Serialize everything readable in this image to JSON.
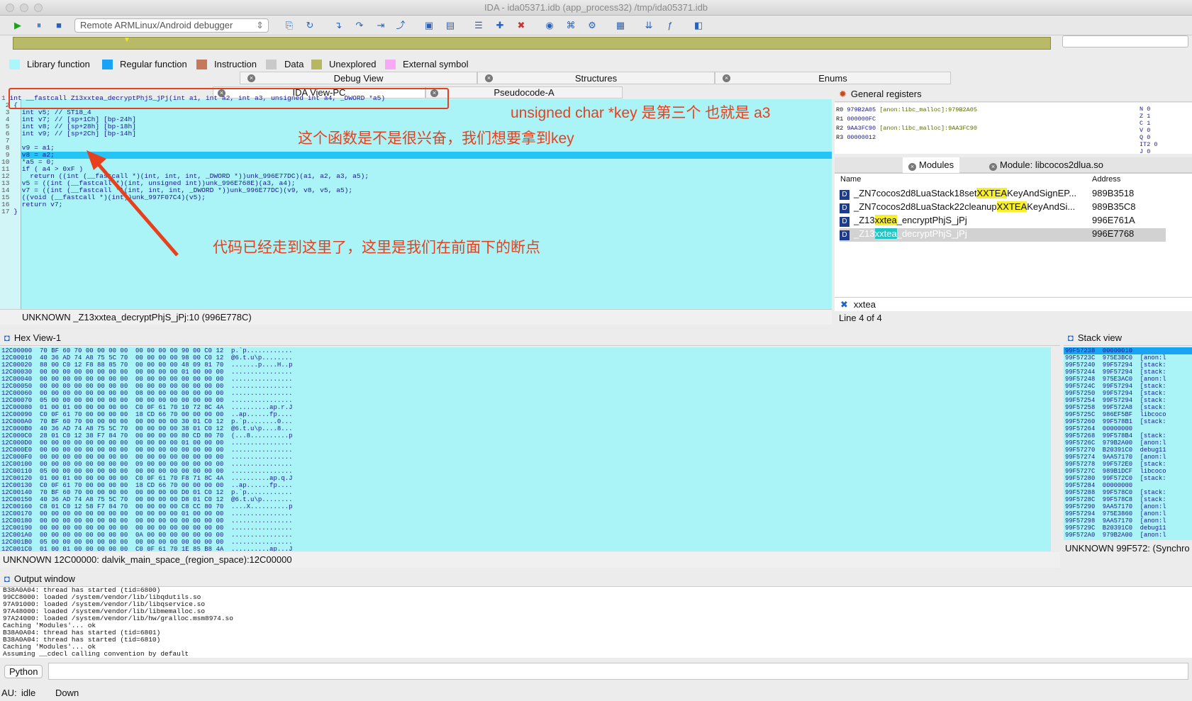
{
  "window": {
    "title": "IDA - ida05371.idb (app_process32) /tmp/ida05371.idb"
  },
  "toolbar": {
    "debugger": "Remote ARMLinux/Android debugger"
  },
  "legend": [
    {
      "label": "Library function",
      "color": "#a9f6fb"
    },
    {
      "label": "Regular function",
      "color": "#19a3f5"
    },
    {
      "label": "Instruction",
      "color": "#c47a5a"
    },
    {
      "label": "Data",
      "color": "#c9c9c9"
    },
    {
      "label": "Unexplored",
      "color": "#b6b861"
    },
    {
      "label": "External symbol",
      "color": "#f8a9f6"
    }
  ],
  "tabs_top": [
    "Debug View",
    "Structures",
    "Enums"
  ],
  "tabs_second": [
    "IDA View-PC",
    "Pseudocode-A"
  ],
  "code": {
    "header": "int __fastcall Z13xxtea_decryptPhjS_jPj(int a1, int a2, int a3, unsigned int a4, _DWORD *a5)",
    "lines": [
      {
        "n": "2",
        "t": "{"
      },
      {
        "n": "3",
        "t": "  int v5; // ST18_4"
      },
      {
        "n": "4",
        "t": "  int v7; // [sp+1Ch] [bp-24h]"
      },
      {
        "n": "5",
        "t": "  int v8; // [sp+28h] [bp-18h]"
      },
      {
        "n": "6",
        "t": "  int v9; // [sp+2Ch] [bp-14h]"
      },
      {
        "n": "7",
        "t": ""
      },
      {
        "n": "8",
        "t": "  v9 = a1;"
      },
      {
        "n": "9",
        "t": "  v8 = a2;"
      },
      {
        "n": "10",
        "t": "  *a5 = 0;"
      },
      {
        "n": "11",
        "t": "  if ( a4 > 0xF )"
      },
      {
        "n": "12",
        "t": "    return ((int (__fastcall *)(int, int, int, _DWORD *))unk_996E77DC)(a1, a2, a3, a5);"
      },
      {
        "n": "13",
        "t": "  v5 = ((int (__fastcall *)(int, unsigned int))unk_996E768E)(a3, a4);"
      },
      {
        "n": "14",
        "t": "  v7 = ((int (__fastcall *)(int, int, int, _DWORD *))unk_996E77DC)(v9, v8, v5, a5);"
      },
      {
        "n": "15",
        "t": "  ((void (__fastcall *)(int))unk_997F07C4)(v5);"
      },
      {
        "n": "16",
        "t": "  return v7;"
      },
      {
        "n": "17",
        "t": "}"
      }
    ]
  },
  "annotations": [
    "unsigned char *key 是第三个 也就是 a3",
    "这个函数是不是很兴奋，我们想要拿到key",
    "代码已经走到这里了，这里是我们在前面下的断点"
  ],
  "idaview_status": "UNKNOWN  _Z13xxtea_decryptPhjS_jPj:10 (996E778C)",
  "registers": {
    "title": "General registers",
    "rows": [
      {
        "r": "R0",
        "v": "979B2A05",
        "n": "[anon:libc_malloc]:979B2A05"
      },
      {
        "r": "R1",
        "v": "000000FC",
        "n": ""
      },
      {
        "r": "R2",
        "v": "9AA3FC90",
        "n": "[anon:libc_malloc]:9AA3FC90"
      },
      {
        "r": "R3",
        "v": "00000012",
        "n": ""
      }
    ],
    "flags": [
      [
        "N",
        "0"
      ],
      [
        "Z",
        "1"
      ],
      [
        "C",
        "1"
      ],
      [
        "V",
        "0"
      ],
      [
        "Q",
        "0"
      ],
      [
        "IT2",
        "0"
      ],
      [
        "J",
        "0"
      ]
    ]
  },
  "modules": {
    "tabs": [
      "Modules",
      "Module: libcocos2dlua.so"
    ],
    "cols": [
      "Name",
      "Address"
    ],
    "rows": [
      {
        "pre": "_ZN7cocos2d8LuaStack18set",
        "hl": "XXTEA",
        "post": "KeyAndSignEP...",
        "addr": "989B3518"
      },
      {
        "pre": "_ZN7cocos2d8LuaStack22cleanup",
        "hl": "XXTEA",
        "post": "KeyAndSi...",
        "addr": "989B35C8"
      },
      {
        "pre": "_Z13",
        "hl": "xxtea",
        "post": "_encryptPhjS_jPj",
        "addr": "996E761A"
      },
      {
        "pre": "_Z13",
        "hl": "xxtea",
        "post": "_decryptPhjS_jPj",
        "addr": "996E7768"
      }
    ],
    "search": "xxtea",
    "line_info": "Line 4 of 4"
  },
  "hexview": {
    "title": "Hex View-1",
    "status": "UNKNOWN  12C00000: dalvik_main_space_(region_space):12C00000",
    "rows": [
      "12C00000  70 BF 60 70 00 00 00 00  00 00 00 00 90 00 C0 12  p.`p............",
      "12C00010  40 36 AD 74 A8 75 5C 70  00 00 00 00 98 00 C0 12  @6.t.u\\p........",
      "12C00020  88 00 C0 12 F8 88 85 70  00 00 00 00 48 09 81 70  .......p....H..p",
      "12C00030  00 00 00 00 00 00 00 00  00 00 00 00 01 00 00 00  ................",
      "12C00040  00 00 00 00 00 00 00 00  00 00 00 00 00 00 00 00  ................",
      "12C00050  00 00 00 00 00 00 00 00  00 00 00 00 00 00 00 00  ................",
      "12C00060  00 00 00 00 00 00 00 00  08 00 00 00 00 00 00 00  ................",
      "12C00070  05 00 00 00 00 00 00 00  00 00 00 00 00 00 00 00  ................",
      "12C00080  01 00 01 00 00 00 00 00  C0 0F 61 70 10 72 8C 4A  ..........ap.r.J",
      "12C00090  C0 0F 61 70 00 00 00 00  18 CD 66 70 00 00 00 00  ..ap......fp....",
      "12C000A0  70 BF 60 70 00 00 00 00  00 00 00 00 30 01 C0 12  p.`p........0...",
      "12C000B0  40 36 AD 74 A8 75 5C 70  00 00 00 00 38 01 C0 12  @6.t.u\\p....8...",
      "12C000C0  28 01 C0 12 38 F7 84 70  00 00 00 00 80 CD 80 70  (...8..........p",
      "12C000D0  00 00 00 00 00 00 00 00  00 00 00 00 01 00 00 00  ................",
      "12C000E0  00 00 00 00 00 00 00 00  00 00 00 00 00 00 00 00  ................",
      "12C000F0  00 00 00 00 00 00 00 00  00 00 00 00 00 00 00 00  ................",
      "12C00100  00 00 00 00 00 00 00 00  09 00 00 00 00 00 00 00  ................",
      "12C00110  05 00 00 00 00 00 00 00  00 00 00 00 00 00 00 00  ................",
      "12C00120  01 00 01 00 00 00 00 00  C0 0F 61 70 F8 71 8C 4A  ..........ap.q.J",
      "12C00130  C0 0F 61 70 00 00 00 00  18 CD 66 70 00 00 00 00  ..ap......fp....",
      "12C00140  70 BF 60 70 00 00 00 00  00 00 00 00 D0 01 C0 12  p.`p............",
      "12C00150  40 36 AD 74 A8 75 5C 70  00 00 00 00 D8 01 C0 12  @6.t.u\\p........",
      "12C00160  C8 01 C0 12 58 F7 84 70  00 00 00 00 C8 CC 80 70  ....X..........p",
      "12C00170  00 00 00 00 00 00 00 00  00 00 00 00 01 00 00 00  ................",
      "12C00180  00 00 00 00 00 00 00 00  00 00 00 00 00 00 00 00  ................",
      "12C00190  00 00 00 00 00 00 00 00  00 00 00 00 00 00 00 00  ................",
      "12C001A0  00 00 00 00 00 00 00 00  0A 00 00 00 00 00 00 00  ................",
      "12C001B0  05 00 00 00 00 00 00 00  00 00 00 00 00 00 00 00  ................",
      "12C001C0  01 00 01 00 00 00 00 00  C0 0F 61 70 1E 85 B8 4A  ..........ap...J"
    ]
  },
  "stack": {
    "title": "Stack view",
    "status": "UNKNOWN 99F572: (Synchro",
    "rows": [
      "99F57238  00000010",
      "99F5723C  975E3BC0  [anon:l",
      "99F57240  99F57294  [stack:",
      "99F57244  99F57294  [stack:",
      "99F57248  975E3AC0  [anon:l",
      "99F5724C  99F57294  [stack:",
      "99F57250  99F57294  [stack:",
      "99F57254  99F57294  [stack:",
      "99F57258  99F572A8  [stack:",
      "99F5725C  986EF5BF  libcoco",
      "99F57260  99F578B1  [stack:",
      "99F57264  00000000",
      "99F57268  99F578B4  [stack:",
      "99F5726C  979B2A00  [anon:l",
      "99F57270  B20391C0  debug11",
      "99F57274  9AA57170  [anon:l",
      "99F57278  99F572E0  [stack:",
      "99F5727C  989B1DCF  libcoco",
      "99F57280  99F572C0  [stack:",
      "99F57284  00000000",
      "99F57288  99F578C0  [stack:",
      "99F5728C  99F578C8  [stack:",
      "99F57290  9AA57170  [anon:l",
      "99F57294  975E3860  [anon:l",
      "99F57298  9AA57170  [anon:l",
      "99F5729C  B20391C0  debug11",
      "99F572A0  979B2A00  [anon:l"
    ]
  },
  "output": {
    "title": "Output window",
    "lines": [
      "B38A0A04: thread has started (tid=6800)",
      "99CC8000: loaded /system/vendor/lib/libqdutils.so",
      "97A91000: loaded /system/vendor/lib/libqservice.so",
      "97A48000: loaded /system/vendor/lib/libmemalloc.so",
      "97A24000: loaded /system/vendor/lib/hw/gralloc.msm8974.so",
      "Caching 'Modules'... ok",
      "B38A0A04: thread has started (tid=6801)",
      "B38A0A04: thread has started (tid=6810)",
      "Caching 'Modules'... ok",
      "Assuming __cdecl calling convention by default"
    ],
    "python": "Python"
  },
  "status": {
    "au": "AU:",
    "state": "idle",
    "dir": "Down"
  }
}
